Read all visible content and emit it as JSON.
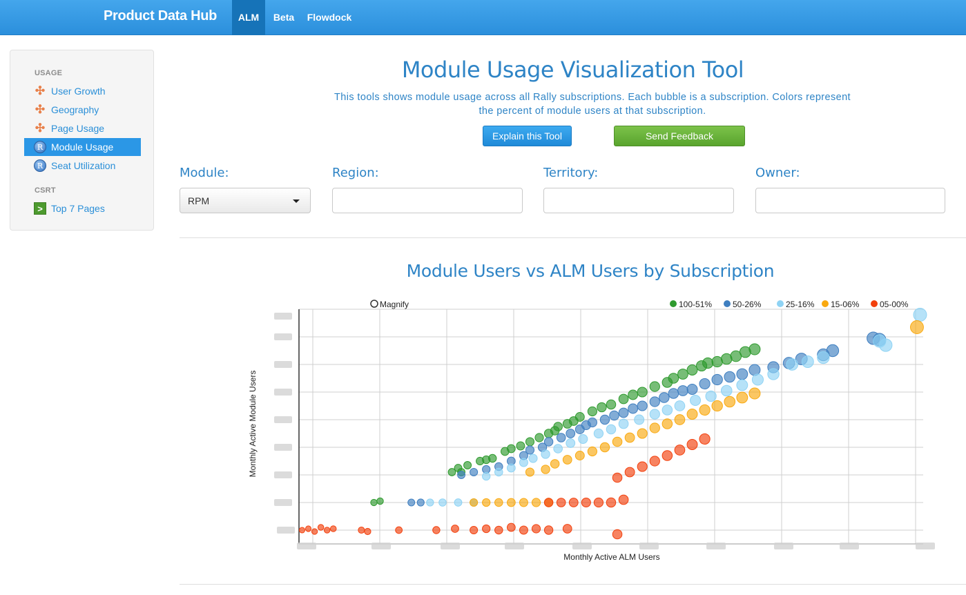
{
  "navbar": {
    "brand": "Product Data Hub",
    "items": [
      {
        "label": "ALM",
        "active": true
      },
      {
        "label": "Beta",
        "active": false
      },
      {
        "label": "Flowdock",
        "active": false
      }
    ]
  },
  "sidebar": {
    "sections": [
      {
        "header": "USAGE",
        "items": [
          {
            "label": "User Growth",
            "icon": "tableau-icon",
            "active": false
          },
          {
            "label": "Geography",
            "icon": "tableau-icon",
            "active": false
          },
          {
            "label": "Page Usage",
            "icon": "tableau-icon",
            "active": false
          },
          {
            "label": "Module Usage",
            "icon": "r-icon",
            "active": true
          },
          {
            "label": "Seat Utilization",
            "icon": "r-icon",
            "active": false
          }
        ]
      },
      {
        "header": "CSRT",
        "items": [
          {
            "label": "Top 7 Pages",
            "icon": "go-arrow-icon",
            "active": false
          }
        ]
      }
    ]
  },
  "header": {
    "title": "Module Usage Visualization Tool",
    "description": "This tools shows module usage across all Rally subscriptions. Each bubble is a subscription. Colors represent the percent of module users at that subscription.",
    "explain_button": "Explain this Tool",
    "feedback_button": "Send Feedback"
  },
  "filters": {
    "module": {
      "label": "Module:",
      "value": "RPM"
    },
    "region": {
      "label": "Region:",
      "value": "",
      "placeholder": ""
    },
    "territory": {
      "label": "Territory:",
      "value": "",
      "placeholder": ""
    },
    "owner": {
      "label": "Owner:",
      "value": "",
      "placeholder": ""
    }
  },
  "colors": {
    "accent": "#2e84c6",
    "nav": "#2b8fdc",
    "band_100_51": "#2e9a2e",
    "band_50_26": "#3f7fc0",
    "band_25_16": "#8fd3f4",
    "band_15_06": "#f9a90f",
    "band_05_00": "#f2400d"
  },
  "chart_data": {
    "type": "scatter",
    "title": "Module Users vs ALM Users by Subscription",
    "xlabel": "Monthly Active ALM Users",
    "ylabel": "Monthly Active Module Users",
    "magnify_label": "Magnify",
    "tick_labels_obscured": true,
    "grid": true,
    "legend_position": "top-right",
    "xlim": [
      0,
      10
    ],
    "ylim": [
      0,
      8
    ],
    "series": [
      {
        "name": "100-51%",
        "color": "#2e9a2e",
        "points": [
          [
            1.2,
            1
          ],
          [
            1.3,
            1.05
          ],
          [
            2.45,
            2.1
          ],
          [
            2.6,
            2.1
          ],
          [
            2.55,
            2.25
          ],
          [
            2.7,
            2.35
          ],
          [
            2.9,
            2.5
          ],
          [
            3.0,
            2.55
          ],
          [
            3.1,
            2.6
          ],
          [
            3.3,
            2.85
          ],
          [
            3.4,
            2.95
          ],
          [
            3.55,
            3.05
          ],
          [
            3.7,
            3.2
          ],
          [
            3.85,
            3.35
          ],
          [
            4.0,
            3.5
          ],
          [
            4.1,
            3.6
          ],
          [
            4.15,
            3.75
          ],
          [
            4.3,
            3.85
          ],
          [
            4.4,
            3.95
          ],
          [
            4.5,
            4.1
          ],
          [
            4.7,
            4.3
          ],
          [
            4.85,
            4.45
          ],
          [
            5.0,
            4.55
          ],
          [
            5.2,
            4.75
          ],
          [
            5.35,
            4.9
          ],
          [
            5.5,
            5.0
          ],
          [
            5.7,
            5.2
          ],
          [
            5.9,
            5.35
          ],
          [
            6.0,
            5.5
          ],
          [
            6.15,
            5.65
          ],
          [
            6.3,
            5.8
          ],
          [
            6.45,
            5.95
          ],
          [
            6.55,
            6.05
          ],
          [
            6.7,
            6.1
          ],
          [
            6.85,
            6.2
          ],
          [
            7.0,
            6.3
          ],
          [
            7.15,
            6.45
          ],
          [
            7.3,
            6.55
          ]
        ]
      },
      {
        "name": "50-26%",
        "color": "#3f7fc0",
        "points": [
          [
            1.8,
            1
          ],
          [
            1.95,
            1
          ],
          [
            2.6,
            2.0
          ],
          [
            2.8,
            2.1
          ],
          [
            3.0,
            2.2
          ],
          [
            3.2,
            2.3
          ],
          [
            3.4,
            2.5
          ],
          [
            3.6,
            2.7
          ],
          [
            3.7,
            2.9
          ],
          [
            3.9,
            3.0
          ],
          [
            4.0,
            3.2
          ],
          [
            4.2,
            3.35
          ],
          [
            4.35,
            3.5
          ],
          [
            4.5,
            3.65
          ],
          [
            4.6,
            3.8
          ],
          [
            4.7,
            3.9
          ],
          [
            4.9,
            4.0
          ],
          [
            5.05,
            4.15
          ],
          [
            5.2,
            4.25
          ],
          [
            5.35,
            4.4
          ],
          [
            5.5,
            4.5
          ],
          [
            5.7,
            4.65
          ],
          [
            5.85,
            4.8
          ],
          [
            6.0,
            4.95
          ],
          [
            6.15,
            5.05
          ],
          [
            6.3,
            5.1
          ],
          [
            6.5,
            5.3
          ],
          [
            6.7,
            5.45
          ],
          [
            6.9,
            5.55
          ],
          [
            7.1,
            5.65
          ],
          [
            7.3,
            5.8
          ],
          [
            7.6,
            5.9
          ],
          [
            7.85,
            6.05
          ],
          [
            8.05,
            6.2
          ],
          [
            8.4,
            6.35
          ],
          [
            8.55,
            6.5
          ],
          [
            9.2,
            6.95
          ],
          [
            9.3,
            6.9
          ]
        ]
      },
      {
        "name": "25-16%",
        "color": "#8fd3f4",
        "points": [
          [
            2.1,
            1
          ],
          [
            2.3,
            1
          ],
          [
            2.55,
            1
          ],
          [
            2.8,
            1
          ],
          [
            3.0,
            1.95
          ],
          [
            3.2,
            2.1
          ],
          [
            3.4,
            2.25
          ],
          [
            3.6,
            2.45
          ],
          [
            3.75,
            2.6
          ],
          [
            3.95,
            2.75
          ],
          [
            4.15,
            2.95
          ],
          [
            4.35,
            3.15
          ],
          [
            4.55,
            3.3
          ],
          [
            4.8,
            3.5
          ],
          [
            5.0,
            3.65
          ],
          [
            5.2,
            3.85
          ],
          [
            5.45,
            4.0
          ],
          [
            5.7,
            4.2
          ],
          [
            5.9,
            4.35
          ],
          [
            6.1,
            4.5
          ],
          [
            6.35,
            4.7
          ],
          [
            6.6,
            4.85
          ],
          [
            6.85,
            5.05
          ],
          [
            7.1,
            5.25
          ],
          [
            7.35,
            5.45
          ],
          [
            7.6,
            5.65
          ],
          [
            7.9,
            6.0
          ],
          [
            8.15,
            6.1
          ],
          [
            8.4,
            6.25
          ],
          [
            9.4,
            6.7
          ],
          [
            9.3,
            6.85
          ],
          [
            9.95,
            7.8
          ]
        ]
      },
      {
        "name": "15-06%",
        "color": "#f9a90f",
        "points": [
          [
            2.8,
            1
          ],
          [
            3.0,
            1
          ],
          [
            3.2,
            1
          ],
          [
            3.4,
            1
          ],
          [
            3.6,
            1
          ],
          [
            3.8,
            1
          ],
          [
            4.0,
            1
          ],
          [
            3.7,
            2.1
          ],
          [
            3.95,
            2.2
          ],
          [
            4.1,
            2.4
          ],
          [
            4.3,
            2.55
          ],
          [
            4.5,
            2.7
          ],
          [
            4.7,
            2.85
          ],
          [
            4.9,
            3.0
          ],
          [
            5.1,
            3.2
          ],
          [
            5.3,
            3.35
          ],
          [
            5.5,
            3.5
          ],
          [
            5.7,
            3.7
          ],
          [
            5.9,
            3.85
          ],
          [
            6.1,
            4.0
          ],
          [
            6.3,
            4.2
          ],
          [
            6.5,
            4.35
          ],
          [
            6.7,
            4.5
          ],
          [
            6.9,
            4.65
          ],
          [
            7.1,
            4.8
          ],
          [
            7.3,
            4.95
          ],
          [
            9.9,
            7.35
          ]
        ]
      },
      {
        "name": "05-00%",
        "color": "#f2400d",
        "points": [
          [
            0.05,
            0
          ],
          [
            0.15,
            0.05
          ],
          [
            0.25,
            -0.05
          ],
          [
            0.35,
            0.1
          ],
          [
            0.45,
            0
          ],
          [
            0.55,
            0.05
          ],
          [
            1.0,
            0
          ],
          [
            1.1,
            -0.05
          ],
          [
            1.6,
            0
          ],
          [
            2.2,
            0
          ],
          [
            2.5,
            0.05
          ],
          [
            2.8,
            0
          ],
          [
            3.0,
            0.05
          ],
          [
            3.2,
            0
          ],
          [
            3.4,
            0.1
          ],
          [
            3.6,
            0
          ],
          [
            3.8,
            0.05
          ],
          [
            4.0,
            0
          ],
          [
            4.3,
            0.05
          ],
          [
            4.0,
            1
          ],
          [
            4.2,
            1
          ],
          [
            4.4,
            1
          ],
          [
            4.6,
            1
          ],
          [
            4.8,
            1
          ],
          [
            5.0,
            1
          ],
          [
            5.2,
            1.1
          ],
          [
            5.1,
            1.9
          ],
          [
            5.3,
            2.1
          ],
          [
            5.5,
            2.3
          ],
          [
            5.7,
            2.5
          ],
          [
            5.9,
            2.7
          ],
          [
            6.1,
            2.9
          ],
          [
            6.3,
            3.1
          ],
          [
            6.5,
            3.3
          ],
          [
            5.1,
            -0.15
          ]
        ]
      }
    ]
  }
}
